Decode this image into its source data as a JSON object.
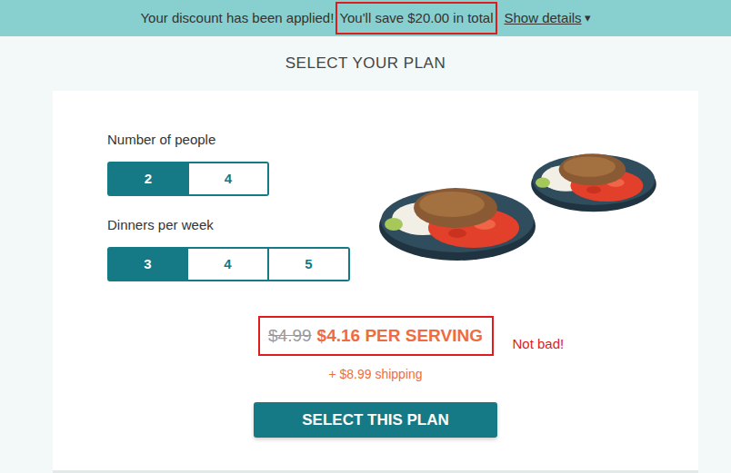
{
  "banner": {
    "message": "Your discount has been applied!",
    "highlight": "You'll save $20.00 in total",
    "link": "Show details",
    "link_icon": "▾"
  },
  "title": "SELECT YOUR PLAN",
  "people": {
    "label": "Number of people",
    "options": [
      {
        "label": "2",
        "selected": true
      },
      {
        "label": "4",
        "selected": false
      }
    ]
  },
  "dinners": {
    "label": "Dinners per week",
    "options": [
      {
        "label": "3",
        "selected": true
      },
      {
        "label": "4",
        "selected": false
      },
      {
        "label": "5",
        "selected": false
      }
    ]
  },
  "price": {
    "original": "$4.99",
    "current": "$4.16 PER SERVING",
    "shipping": "+ $8.99 shipping"
  },
  "annotation": "Not bad!",
  "button": "SELECT THIS PLAN"
}
